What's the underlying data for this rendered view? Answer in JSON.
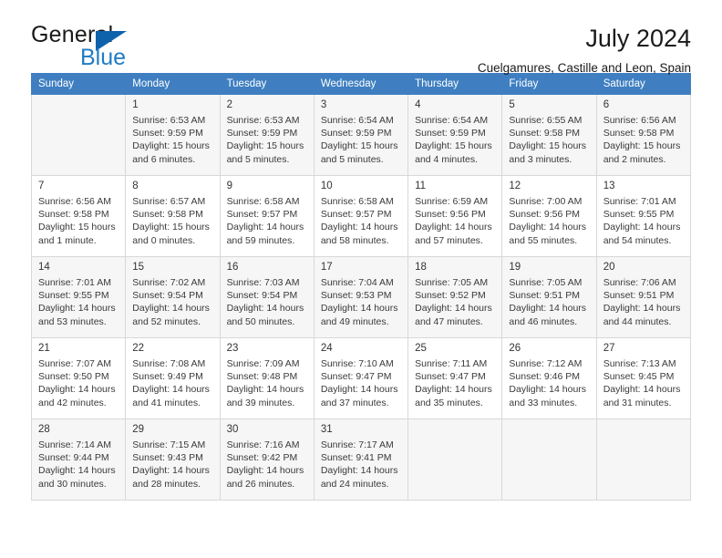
{
  "brand": {
    "name_part1": "General",
    "name_part2": "Blue",
    "triangle_color": "#0e62ab",
    "blue_color": "#1f7cc4"
  },
  "header": {
    "month_title": "July 2024",
    "location": "Cuelgamures, Castille and Leon, Spain"
  },
  "theme": {
    "header_row_bg": "#3f7fc1",
    "alt_row_bg": "#f6f6f6",
    "grid_border": "#d8d8d8"
  },
  "calendar": {
    "weekday_headers": [
      "Sunday",
      "Monday",
      "Tuesday",
      "Wednesday",
      "Thursday",
      "Friday",
      "Saturday"
    ],
    "weeks": [
      [
        {
          "day": "",
          "detail": "",
          "empty": true
        },
        {
          "day": "1",
          "detail": "Sunrise: 6:53 AM\nSunset: 9:59 PM\nDaylight: 15 hours\nand 6 minutes."
        },
        {
          "day": "2",
          "detail": "Sunrise: 6:53 AM\nSunset: 9:59 PM\nDaylight: 15 hours\nand 5 minutes."
        },
        {
          "day": "3",
          "detail": "Sunrise: 6:54 AM\nSunset: 9:59 PM\nDaylight: 15 hours\nand 5 minutes."
        },
        {
          "day": "4",
          "detail": "Sunrise: 6:54 AM\nSunset: 9:59 PM\nDaylight: 15 hours\nand 4 minutes."
        },
        {
          "day": "5",
          "detail": "Sunrise: 6:55 AM\nSunset: 9:58 PM\nDaylight: 15 hours\nand 3 minutes."
        },
        {
          "day": "6",
          "detail": "Sunrise: 6:56 AM\nSunset: 9:58 PM\nDaylight: 15 hours\nand 2 minutes."
        }
      ],
      [
        {
          "day": "7",
          "detail": "Sunrise: 6:56 AM\nSunset: 9:58 PM\nDaylight: 15 hours\nand 1 minute."
        },
        {
          "day": "8",
          "detail": "Sunrise: 6:57 AM\nSunset: 9:58 PM\nDaylight: 15 hours\nand 0 minutes."
        },
        {
          "day": "9",
          "detail": "Sunrise: 6:58 AM\nSunset: 9:57 PM\nDaylight: 14 hours\nand 59 minutes."
        },
        {
          "day": "10",
          "detail": "Sunrise: 6:58 AM\nSunset: 9:57 PM\nDaylight: 14 hours\nand 58 minutes."
        },
        {
          "day": "11",
          "detail": "Sunrise: 6:59 AM\nSunset: 9:56 PM\nDaylight: 14 hours\nand 57 minutes."
        },
        {
          "day": "12",
          "detail": "Sunrise: 7:00 AM\nSunset: 9:56 PM\nDaylight: 14 hours\nand 55 minutes."
        },
        {
          "day": "13",
          "detail": "Sunrise: 7:01 AM\nSunset: 9:55 PM\nDaylight: 14 hours\nand 54 minutes."
        }
      ],
      [
        {
          "day": "14",
          "detail": "Sunrise: 7:01 AM\nSunset: 9:55 PM\nDaylight: 14 hours\nand 53 minutes."
        },
        {
          "day": "15",
          "detail": "Sunrise: 7:02 AM\nSunset: 9:54 PM\nDaylight: 14 hours\nand 52 minutes."
        },
        {
          "day": "16",
          "detail": "Sunrise: 7:03 AM\nSunset: 9:54 PM\nDaylight: 14 hours\nand 50 minutes."
        },
        {
          "day": "17",
          "detail": "Sunrise: 7:04 AM\nSunset: 9:53 PM\nDaylight: 14 hours\nand 49 minutes."
        },
        {
          "day": "18",
          "detail": "Sunrise: 7:05 AM\nSunset: 9:52 PM\nDaylight: 14 hours\nand 47 minutes."
        },
        {
          "day": "19",
          "detail": "Sunrise: 7:05 AM\nSunset: 9:51 PM\nDaylight: 14 hours\nand 46 minutes."
        },
        {
          "day": "20",
          "detail": "Sunrise: 7:06 AM\nSunset: 9:51 PM\nDaylight: 14 hours\nand 44 minutes."
        }
      ],
      [
        {
          "day": "21",
          "detail": "Sunrise: 7:07 AM\nSunset: 9:50 PM\nDaylight: 14 hours\nand 42 minutes."
        },
        {
          "day": "22",
          "detail": "Sunrise: 7:08 AM\nSunset: 9:49 PM\nDaylight: 14 hours\nand 41 minutes."
        },
        {
          "day": "23",
          "detail": "Sunrise: 7:09 AM\nSunset: 9:48 PM\nDaylight: 14 hours\nand 39 minutes."
        },
        {
          "day": "24",
          "detail": "Sunrise: 7:10 AM\nSunset: 9:47 PM\nDaylight: 14 hours\nand 37 minutes."
        },
        {
          "day": "25",
          "detail": "Sunrise: 7:11 AM\nSunset: 9:47 PM\nDaylight: 14 hours\nand 35 minutes."
        },
        {
          "day": "26",
          "detail": "Sunrise: 7:12 AM\nSunset: 9:46 PM\nDaylight: 14 hours\nand 33 minutes."
        },
        {
          "day": "27",
          "detail": "Sunrise: 7:13 AM\nSunset: 9:45 PM\nDaylight: 14 hours\nand 31 minutes."
        }
      ],
      [
        {
          "day": "28",
          "detail": "Sunrise: 7:14 AM\nSunset: 9:44 PM\nDaylight: 14 hours\nand 30 minutes."
        },
        {
          "day": "29",
          "detail": "Sunrise: 7:15 AM\nSunset: 9:43 PM\nDaylight: 14 hours\nand 28 minutes."
        },
        {
          "day": "30",
          "detail": "Sunrise: 7:16 AM\nSunset: 9:42 PM\nDaylight: 14 hours\nand 26 minutes."
        },
        {
          "day": "31",
          "detail": "Sunrise: 7:17 AM\nSunset: 9:41 PM\nDaylight: 14 hours\nand 24 minutes."
        },
        {
          "day": "",
          "detail": "",
          "empty": true
        },
        {
          "day": "",
          "detail": "",
          "empty": true
        },
        {
          "day": "",
          "detail": "",
          "empty": true
        }
      ]
    ]
  }
}
